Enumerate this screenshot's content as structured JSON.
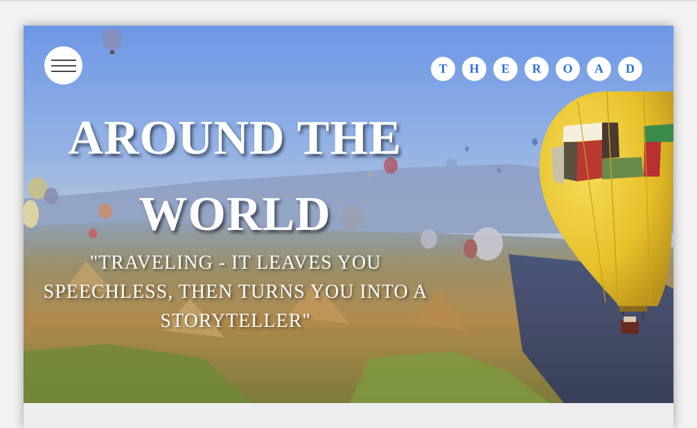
{
  "header": {
    "menu_icon": "hamburger-icon",
    "logo_letters": [
      "T",
      "H",
      "E",
      "R",
      "O",
      "A",
      "D"
    ]
  },
  "hero": {
    "title_line1": "AROUND THE",
    "title_line2": "WORLD",
    "quote": "\"TRAVELING - IT LEAVES YOU SPEECHLESS, THEN TURNS YOU INTO A STORYTELLER\"",
    "background_image": "hot air balloons over valley landscape"
  },
  "colors": {
    "accent": "#2f6fd6",
    "title_text": "#ffffff",
    "page_bg": "#ededed"
  }
}
